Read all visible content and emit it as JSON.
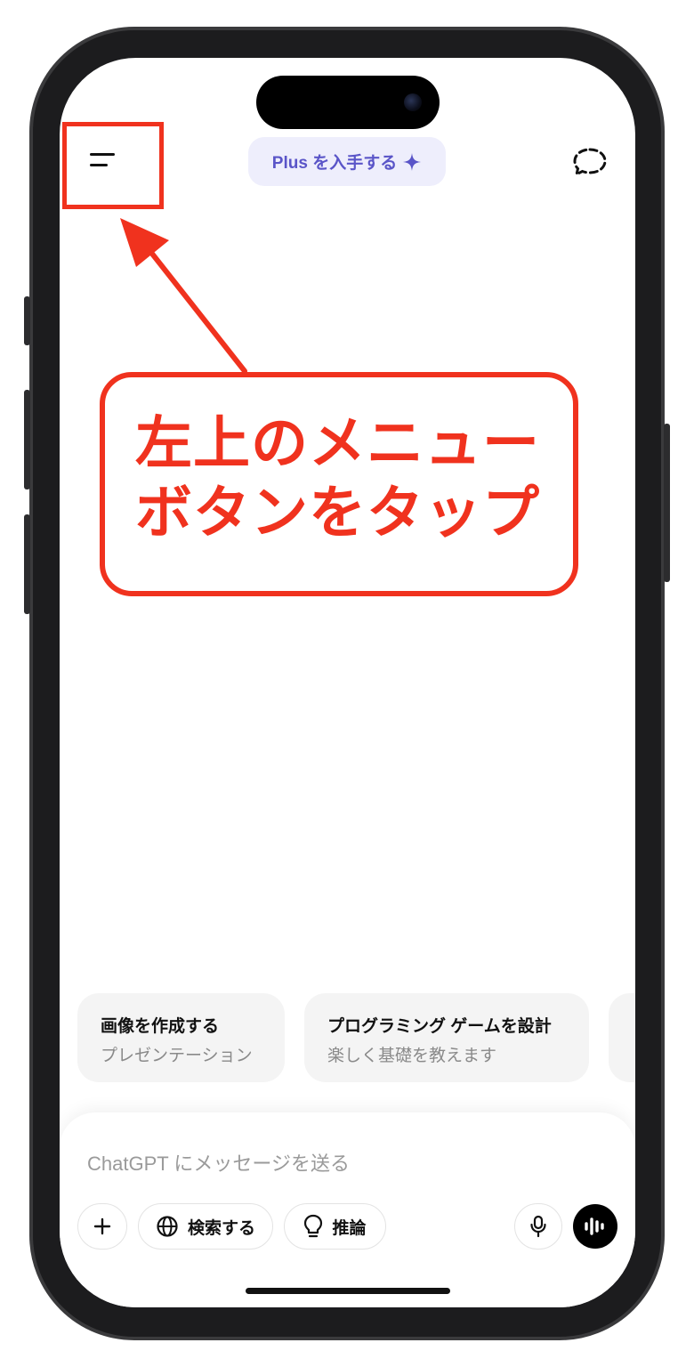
{
  "header": {
    "menu_icon": "menu-icon",
    "plus_label": "Plus を入手する",
    "plus_icon": "sparkle-icon",
    "new_chat_icon": "new-chat-icon",
    "accent_color": "#5a55c8"
  },
  "annotation": {
    "line1": "左上のメニュー",
    "line2": "ボタンをタップ",
    "color": "#f0321e"
  },
  "suggestions": [
    {
      "title": "画像を作成する",
      "subtitle": "プレゼンテーション"
    },
    {
      "title": "プログラミング ゲームを設計",
      "subtitle": "楽しく基礎を教えます"
    }
  ],
  "composer": {
    "placeholder": "ChatGPT にメッセージを送る",
    "add_icon": "plus-icon",
    "search_label": "検索する",
    "search_icon": "globe-icon",
    "reason_label": "推論",
    "reason_icon": "lightbulb-icon",
    "mic_icon": "microphone-icon",
    "voice_icon": "voice-mode-icon"
  }
}
